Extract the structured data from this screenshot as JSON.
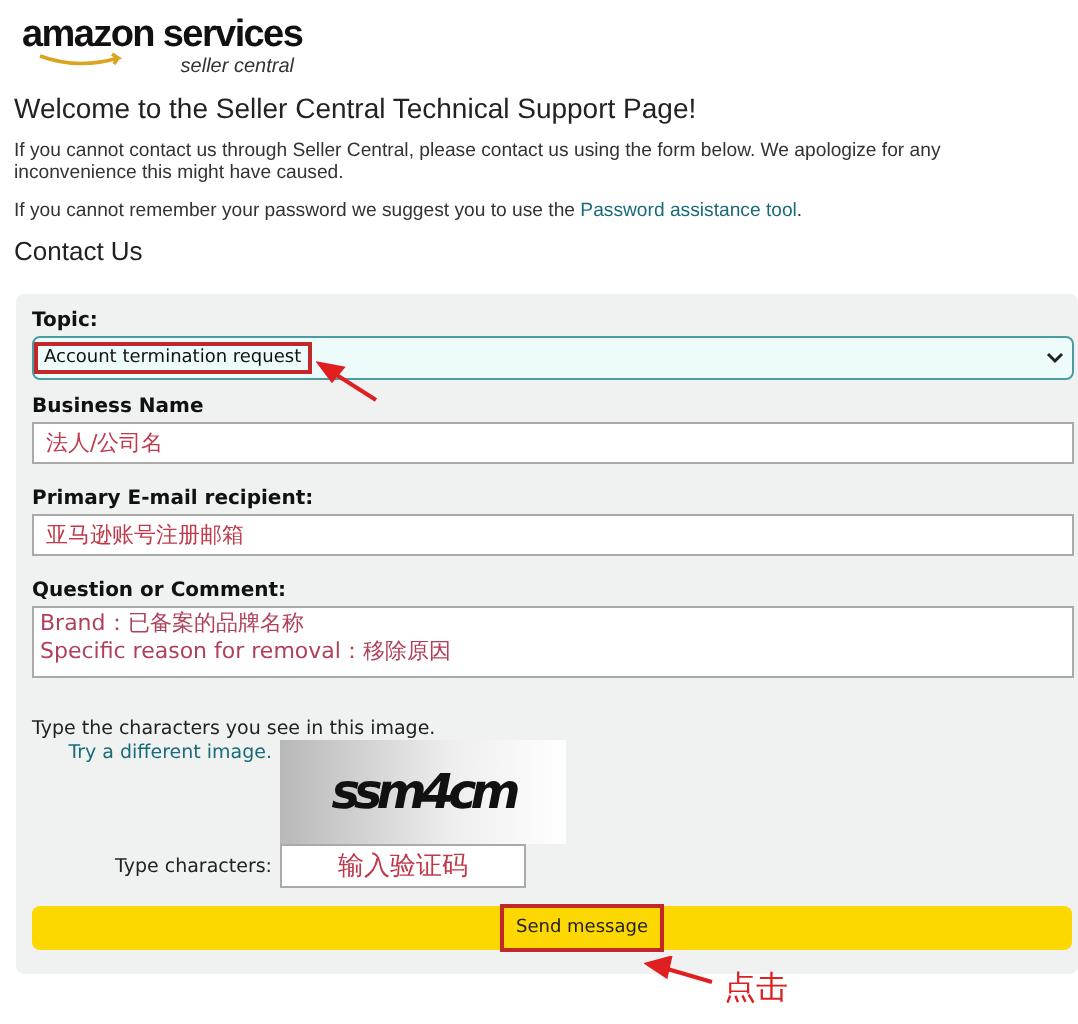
{
  "logo": {
    "brand": "amazon services",
    "tagline": "seller central"
  },
  "heading": "Welcome to the Seller Central Technical Support Page!",
  "intro": "If you cannot contact us through Seller Central, please contact us using the form below. We apologize for any inconvenience this might have caused.",
  "password_note": {
    "text": "If you cannot remember your password we suggest you to use the",
    "link": "Password assistance tool",
    "end": "."
  },
  "section_title": "Contact Us",
  "form": {
    "fields": [
      {
        "kind": "select",
        "label": "Topic:",
        "value": "Account termination request",
        "highlighted": true
      },
      {
        "kind": "text",
        "label": "Business Name",
        "value": "法人/公司名"
      },
      {
        "kind": "text",
        "label": "Primary E-mail recipient:",
        "value": "亚马逊账号注册邮箱"
      },
      {
        "kind": "textarea",
        "label": "Question or Comment:",
        "lines": [
          "Brand：已备案的品牌名称",
          "Specific reason for removal：移除原因"
        ]
      }
    ],
    "captcha": {
      "prompt": "Type the characters you see in this image.",
      "refresh_link": "Try a different image.",
      "image_text": "ssm4cm",
      "input_label": "Type characters:",
      "input_value": "输入验证码"
    },
    "submit": {
      "label": "Send message",
      "highlighted": true
    }
  },
  "annotation": {
    "label": "点击"
  }
}
